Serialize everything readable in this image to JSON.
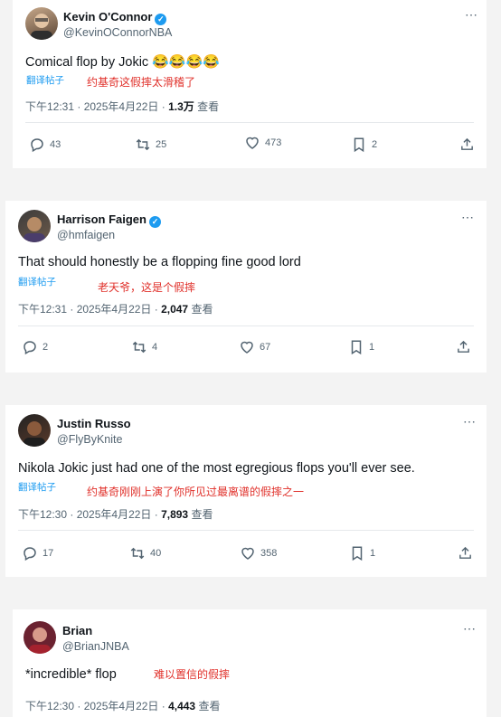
{
  "tweets": [
    {
      "name": "Kevin O'Connor",
      "handle": "@KevinOConnorNBA",
      "text": "Comical flop by Jokic",
      "emoji": "😂😂😂😂",
      "translate": "翻译帖子",
      "translation": "约基奇这假摔太滑稽了",
      "time": "下午12:31 · 2025年4月22日 · ",
      "views": "1.3万",
      "views_label": " 查看",
      "replies": "43",
      "retweets": "25",
      "likes": "473",
      "bookmarks": "2"
    },
    {
      "name": "Harrison Faigen",
      "handle": "@hmfaigen",
      "text": "That should honestly be a flopping fine good lord",
      "translate": "翻译帖子",
      "translation": "老天爷，这是个假摔",
      "time": "下午12:31 · 2025年4月22日 · ",
      "views": "2,047",
      "views_label": " 查看",
      "replies": "2",
      "retweets": "4",
      "likes": "67",
      "bookmarks": "1"
    },
    {
      "name": "Justin Russo",
      "handle": "@FlyByKnite",
      "text": "Nikola Jokic just had one of the most egregious flops you'll ever see.",
      "translate": "翻译帖子",
      "translation": "约基奇刚刚上演了你所见过最离谱的假摔之一",
      "time": "下午12:30 · 2025年4月22日 · ",
      "views": "7,893",
      "views_label": " 查看",
      "replies": "17",
      "retweets": "40",
      "likes": "358",
      "bookmarks": "1"
    },
    {
      "name": "Brian",
      "handle": "@BrianJNBA",
      "text": "*incredible* flop",
      "translation": "难以置信的假摔",
      "time": "下午12:30 · 2025年4月22日 · ",
      "views": "4,443",
      "views_label": " 查看"
    }
  ],
  "more_icon": "⋯",
  "verified_icon": "✓",
  "colors": {
    "link": "#1d9bf0",
    "translation": "#e0302a",
    "muted": "#536471"
  }
}
